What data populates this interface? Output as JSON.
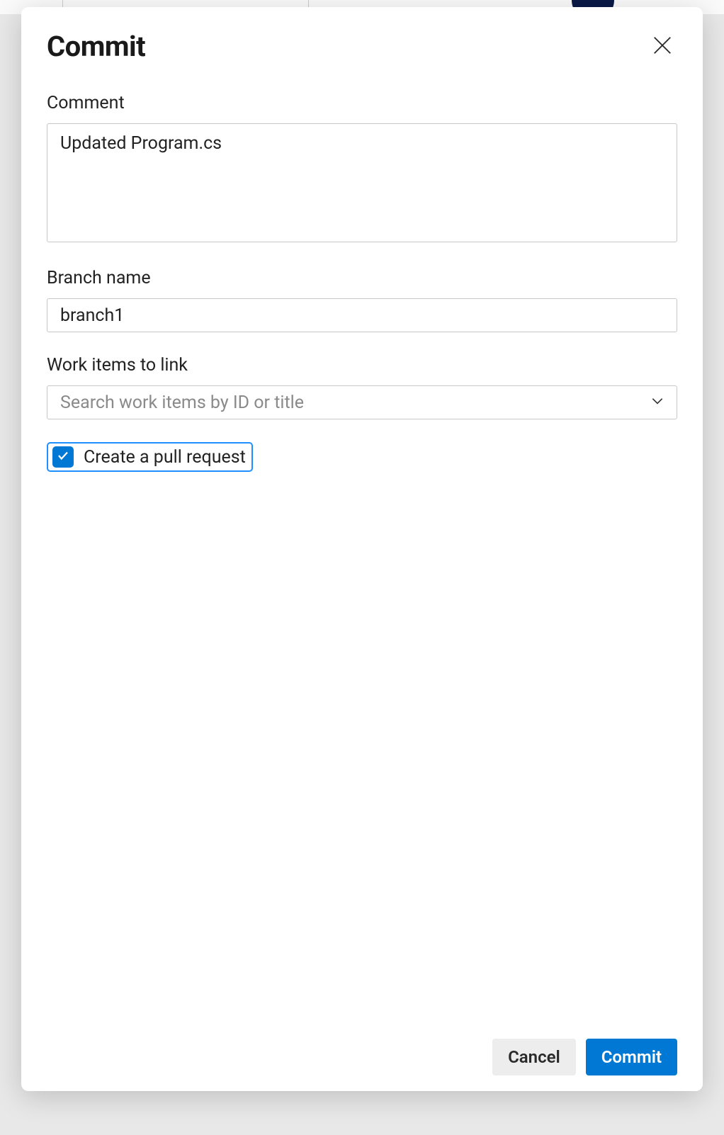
{
  "dialog": {
    "title": "Commit",
    "comment": {
      "label": "Comment",
      "value": "Updated Program.cs"
    },
    "branch": {
      "label": "Branch name",
      "value": "branch1"
    },
    "workItems": {
      "label": "Work items to link",
      "placeholder": "Search work items by ID or title"
    },
    "pullRequest": {
      "label": "Create a pull request",
      "checked": true
    },
    "actions": {
      "cancel": "Cancel",
      "commit": "Commit"
    }
  }
}
